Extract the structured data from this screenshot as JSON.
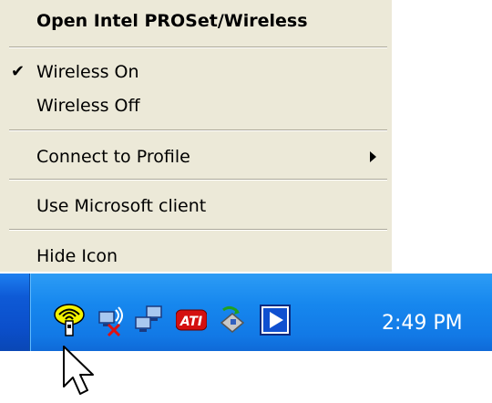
{
  "context_menu": {
    "header": "Open Intel PROSet/Wireless",
    "items": [
      {
        "label": "Wireless On",
        "checked": true
      },
      {
        "label": "Wireless Off",
        "checked": false
      },
      {
        "label": "Connect to Profile",
        "has_submenu": true
      },
      {
        "label": "Use Microsoft client"
      },
      {
        "label": "Hide Icon"
      }
    ],
    "check_glyph": "✔"
  },
  "tray": {
    "icons": [
      "intel-wireless-icon",
      "network-disconnected-icon",
      "network-connected-icon",
      "ati-icon",
      "recycle-icon",
      "media-play-icon"
    ],
    "clock": "2:49 PM"
  },
  "colors": {
    "menu_bg": "#ece9d8",
    "taskbar_blue": "#1687ee"
  }
}
